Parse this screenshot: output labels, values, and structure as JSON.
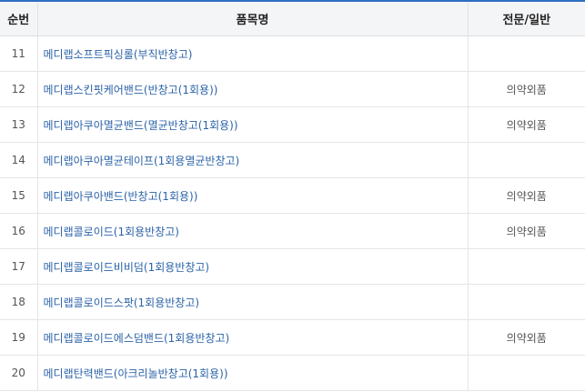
{
  "table": {
    "headers": {
      "number": "순번",
      "product_name": "품목명",
      "category": "전문/일반"
    },
    "rows": [
      {
        "number": "11",
        "product_name": "메디랩소프트픽싱롤(부직반창고)",
        "category": ""
      },
      {
        "number": "12",
        "product_name": "메디랩스킨핏케어밴드(반창고(1회용))",
        "category": "의약외품"
      },
      {
        "number": "13",
        "product_name": "메디랩아쿠아멸균밴드(멸균반창고(1회용))",
        "category": "의약외품"
      },
      {
        "number": "14",
        "product_name": "메디랩아쿠아멸균테이프(1회용멸균반창고)",
        "category": ""
      },
      {
        "number": "15",
        "product_name": "메디랩아쿠아밴드(반창고(1회용))",
        "category": "의약외품"
      },
      {
        "number": "16",
        "product_name": "메디랩콜로이드(1회용반창고)",
        "category": "의약외품"
      },
      {
        "number": "17",
        "product_name": "메디랩콜로이드비비덤(1회용반창고)",
        "category": ""
      },
      {
        "number": "18",
        "product_name": "메디랩콜로이드스팟(1회용반창고)",
        "category": ""
      },
      {
        "number": "19",
        "product_name": "메디랩콜로이드에스덤밴드(1회용반창고)",
        "category": "의약외품"
      },
      {
        "number": "20",
        "product_name": "메디랩탄력밴드(아크리놀반창고(1회용))",
        "category": ""
      }
    ]
  },
  "colors": {
    "accent_top_border": "#2f6ec4",
    "link_text": "#2c63a8",
    "header_bg": "#f4f5f7"
  }
}
